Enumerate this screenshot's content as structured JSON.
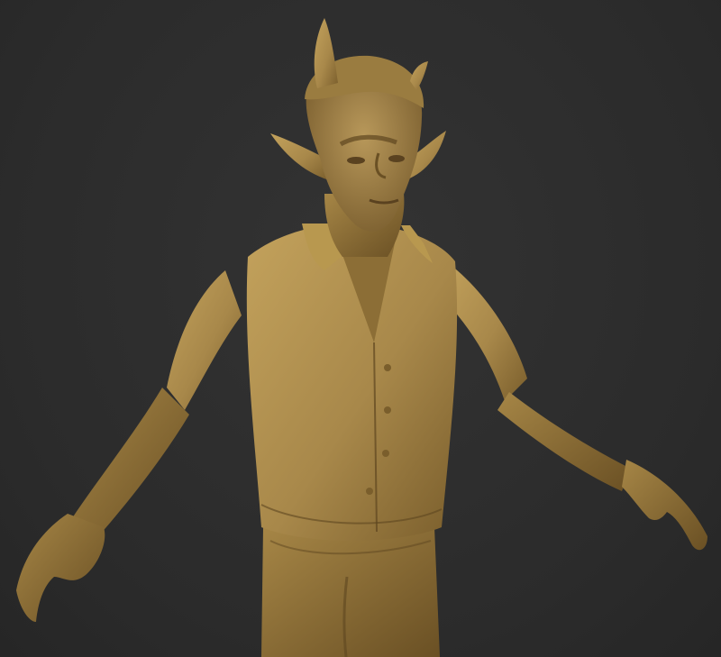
{
  "scene": {
    "subject": "",
    "background_color": "#2d2d2d",
    "clay_color": "#a8884a",
    "clay_shadow": "#6e5426",
    "clay_highlight": "#c8a862"
  }
}
